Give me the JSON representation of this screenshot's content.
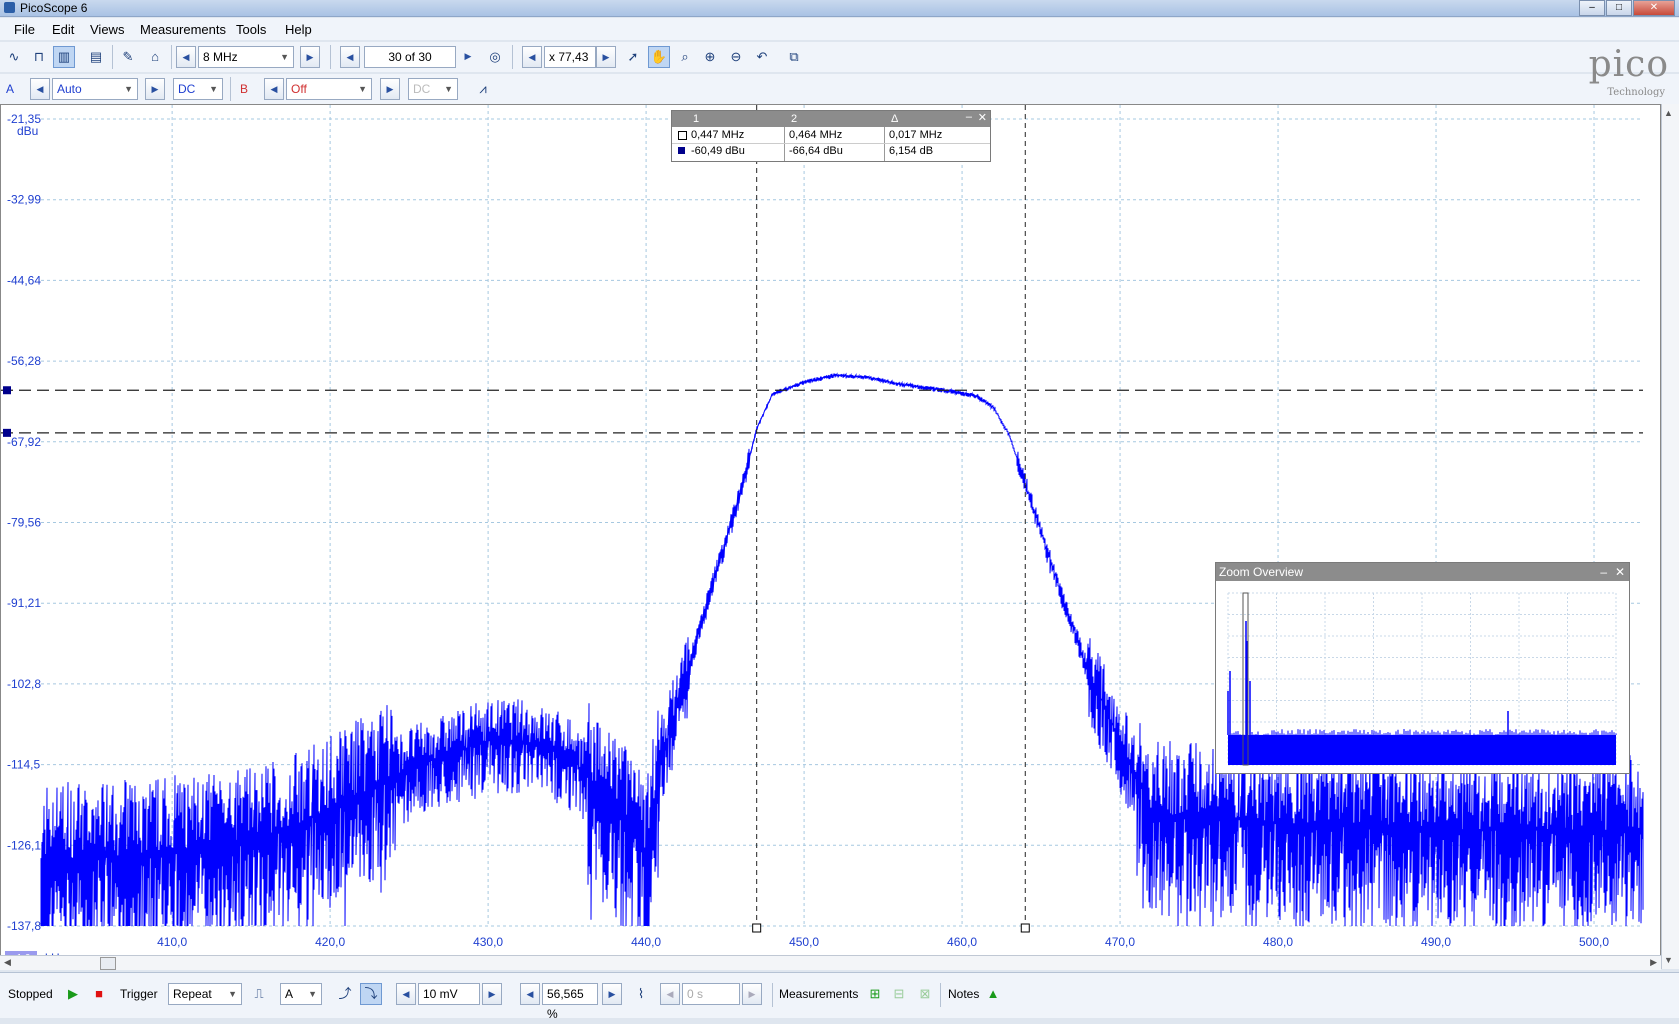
{
  "window": {
    "title": "PicoScope 6"
  },
  "menu": [
    "File",
    "Edit",
    "Views",
    "Measurements",
    "Tools",
    "Help"
  ],
  "toolbar1": {
    "range_value": "8 MHz",
    "buffer_value": "30 of 30",
    "zoom_value": "x 77,43"
  },
  "toolbar2": {
    "channel_a_label": "A",
    "channel_a_range": "Auto",
    "channel_a_coupling": "DC",
    "channel_b_label": "B",
    "channel_b_range": "Off",
    "channel_b_coupling": "DC"
  },
  "logo": {
    "brand": "pico",
    "sub": "Technology"
  },
  "plot": {
    "y_unit": "dBu",
    "y_ticks": [
      "-21,35",
      "-32,99",
      "-44,64",
      "-56,28",
      "-67,92",
      "-79,56",
      "-91,21",
      "-102,8",
      "-114,5",
      "-126,1",
      "-137,8"
    ],
    "x_ticks": [
      "410,0",
      "420,0",
      "430,0",
      "440,0",
      "450,0",
      "460,0",
      "470,0",
      "480,0",
      "490,0",
      "500,0"
    ],
    "x_unit": "kHz",
    "zoom_badge": "x1,0"
  },
  "chart_data": {
    "type": "line",
    "xlabel": "kHz",
    "ylabel": "dBu",
    "xlim": [
      401.7,
      503.1
    ],
    "ylim": [
      -137.8,
      -21.35
    ],
    "series": [
      {
        "x": [
          401.7,
          405,
          410,
          415,
          420,
          425,
          430,
          432,
          435,
          438,
          440,
          441,
          442,
          444,
          446,
          447,
          448,
          450,
          452,
          454,
          456,
          458,
          460,
          461,
          462,
          463,
          464,
          466,
          468,
          470,
          471,
          472,
          475,
          480,
          485,
          490,
          495,
          500,
          503
        ],
        "y": [
          -128,
          -128,
          -127,
          -126,
          -121,
          -115,
          -111,
          -111,
          -113,
          -120,
          -128,
          -113,
          -106,
          -90,
          -75,
          -66,
          -61,
          -59.3,
          -58.3,
          -58.6,
          -59.6,
          -60.2,
          -60.9,
          -61.4,
          -63,
          -67,
          -74,
          -88,
          -101,
          -111,
          -116,
          -122,
          -122,
          -123,
          -123,
          -124,
          -124,
          -124,
          -124
        ]
      }
    ],
    "cursors": {
      "x": [
        447,
        464
      ],
      "y": [
        -60.49,
        -66.64
      ]
    }
  },
  "measurements": {
    "headers": [
      "1",
      "2",
      "Δ"
    ],
    "rows": [
      [
        "0,447 MHz",
        "0,464 MHz",
        "0,017 MHz"
      ],
      [
        "-60,49 dBu",
        "-66,64 dBu",
        "6,154 dB"
      ]
    ]
  },
  "zoom_overview": {
    "title": "Zoom Overview"
  },
  "statusbar": {
    "state": "Stopped",
    "trigger_label": "Trigger",
    "trigger_mode": "Repeat",
    "trigger_channel": "A",
    "trigger_level": "10 mV",
    "pre_trigger": "56,565 %",
    "delay": "0 s",
    "measurements_label": "Measurements",
    "notes_label": "Notes"
  },
  "colors": {
    "trace": "#0000ff",
    "axis_text": "#1f3fd0",
    "grid": "#a6c8e0"
  }
}
